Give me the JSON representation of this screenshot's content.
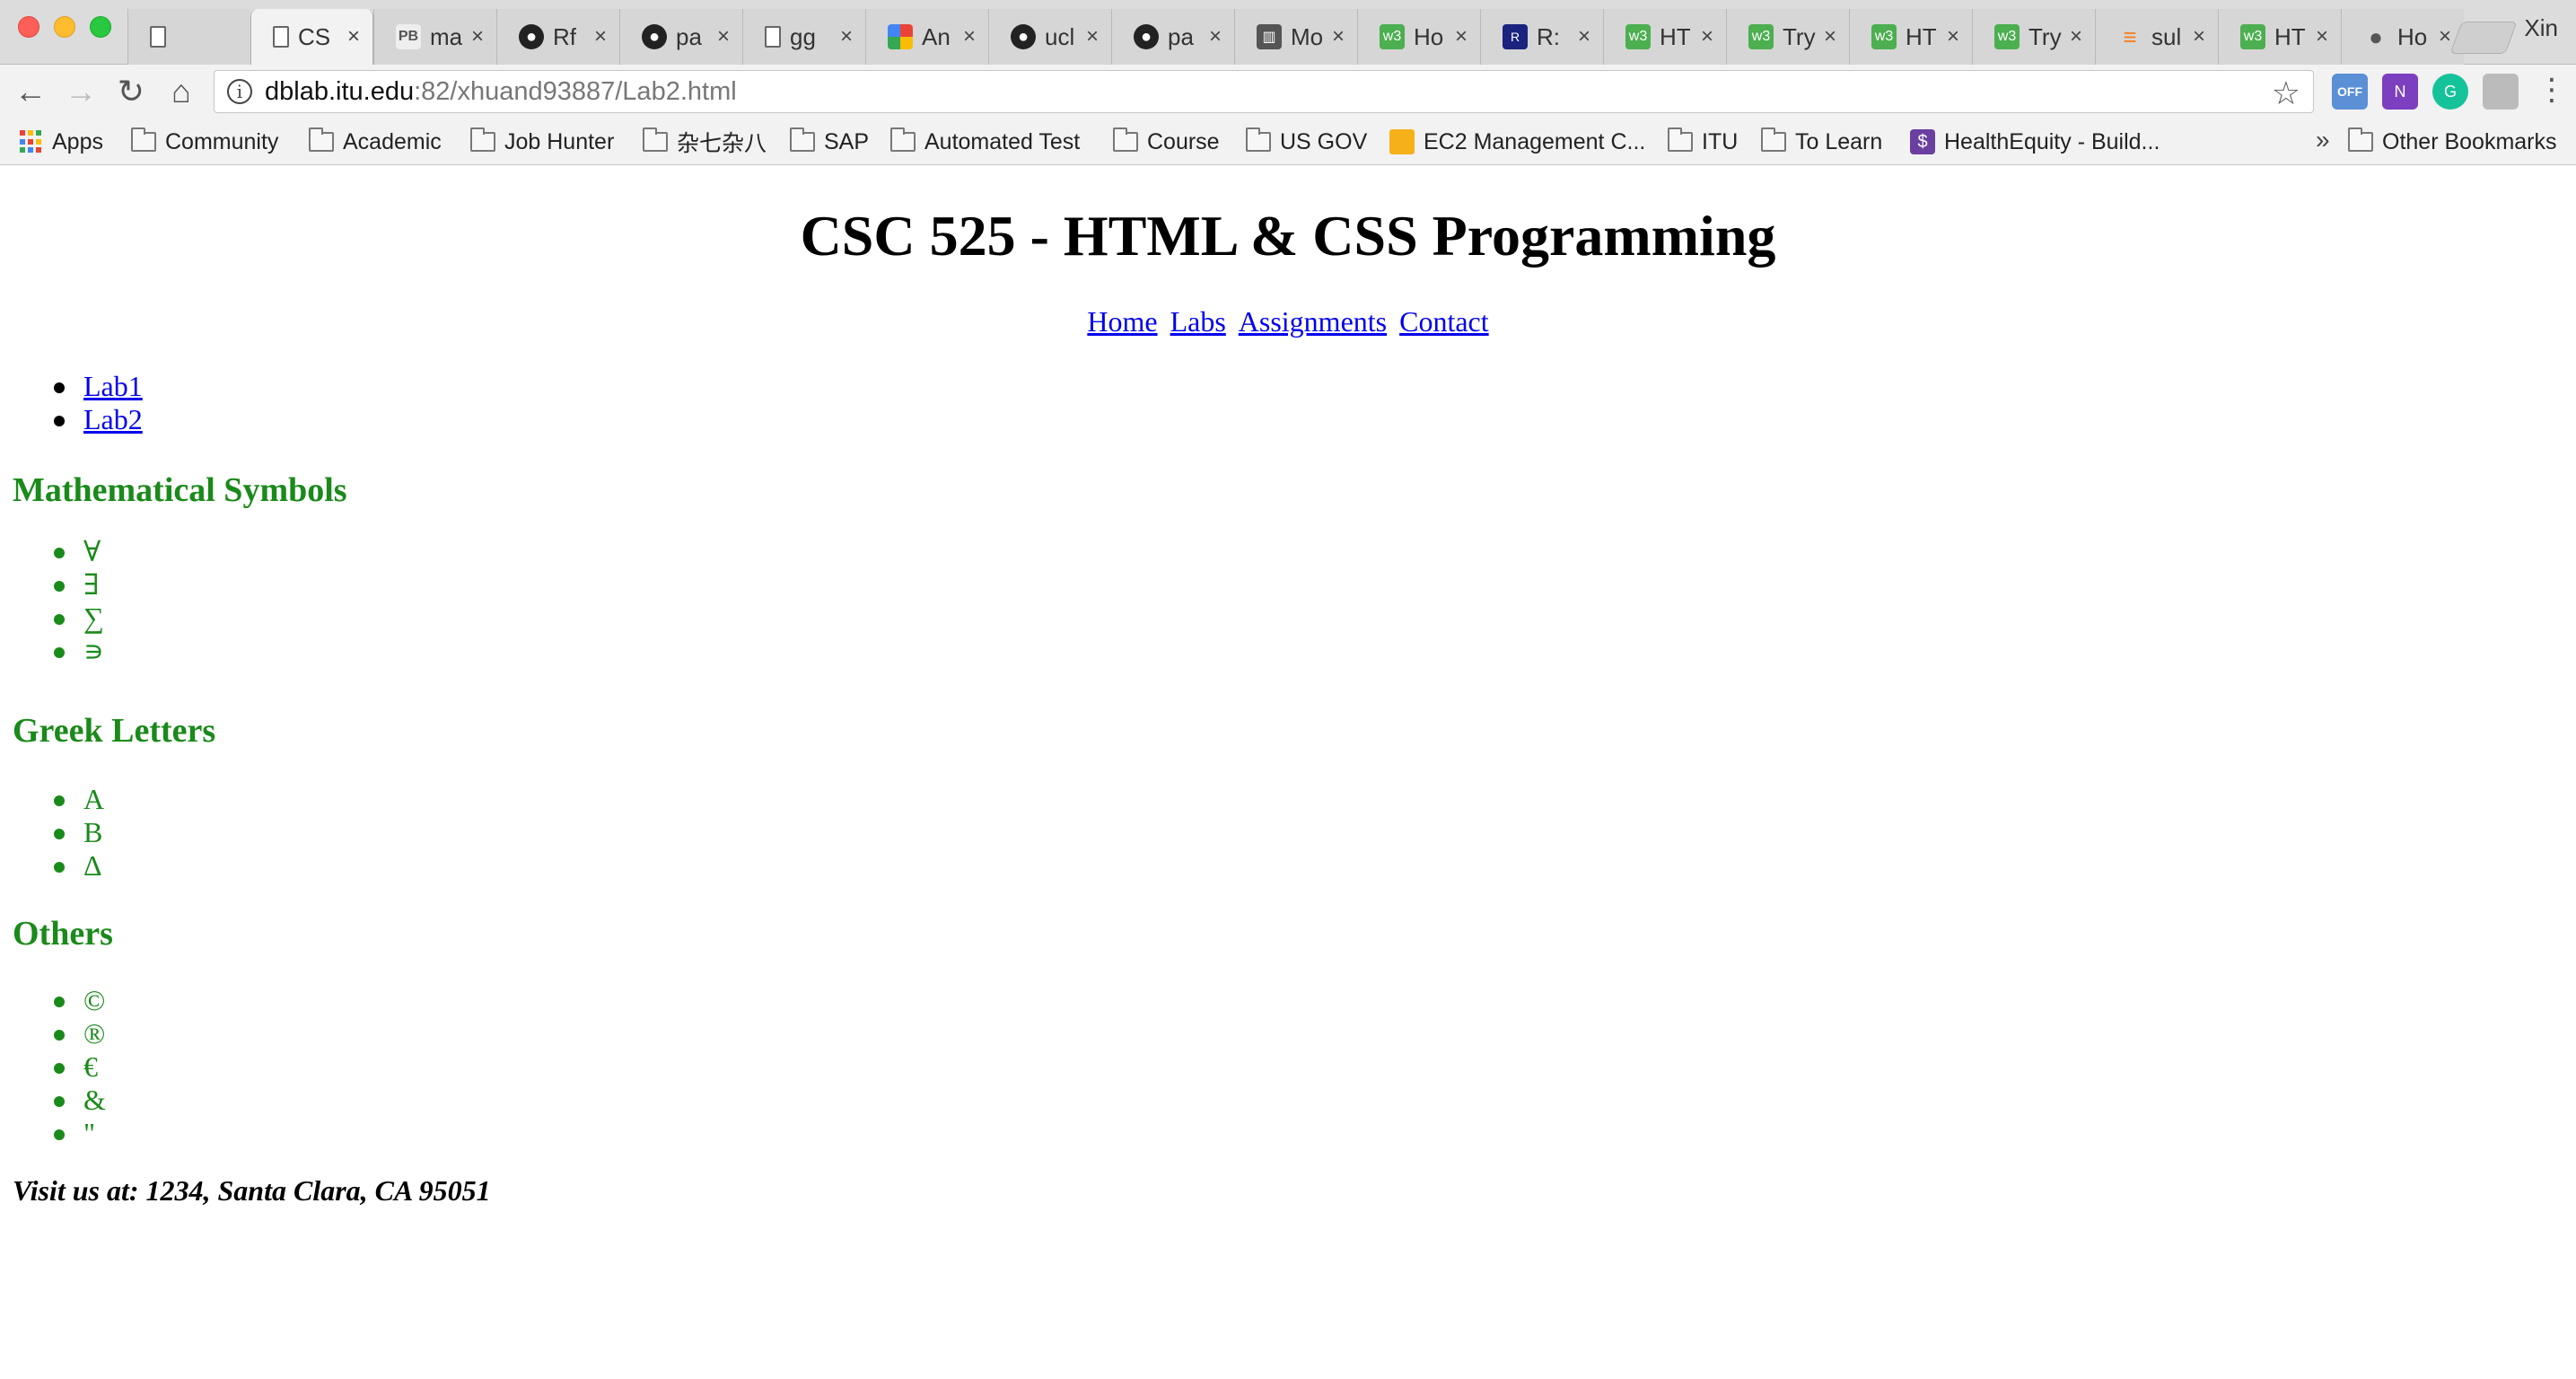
{
  "browser": {
    "tabs": [
      {
        "icon": "page-icon",
        "title": "",
        "active": false
      },
      {
        "icon": "page-icon",
        "title": "CS",
        "active": true
      },
      {
        "icon": "pb-icon",
        "title": "ma",
        "active": false
      },
      {
        "icon": "github-icon",
        "title": "Rf",
        "active": false
      },
      {
        "icon": "github-icon",
        "title": "pa",
        "active": false
      },
      {
        "icon": "page-icon",
        "title": "gg",
        "active": false
      },
      {
        "icon": "colorful-grid-icon",
        "title": "An",
        "active": false
      },
      {
        "icon": "github-icon",
        "title": "ucl",
        "active": false
      },
      {
        "icon": "github-icon",
        "title": "pa",
        "active": false
      },
      {
        "icon": "book-icon",
        "title": "Mo",
        "active": false
      },
      {
        "icon": "w3schools-icon",
        "title": "Ho",
        "active": false
      },
      {
        "icon": "r-icon",
        "title": "R:",
        "active": false
      },
      {
        "icon": "w3schools-icon",
        "title": "HT",
        "active": false
      },
      {
        "icon": "w3schools-icon",
        "title": "Try",
        "active": false
      },
      {
        "icon": "w3schools-icon",
        "title": "HT",
        "active": false
      },
      {
        "icon": "w3schools-icon",
        "title": "Try",
        "active": false
      },
      {
        "icon": "stackoverflow-icon",
        "title": "sul",
        "active": false
      },
      {
        "icon": "w3schools-icon",
        "title": "HT",
        "active": false
      },
      {
        "icon": "apple-icon",
        "title": "Ho",
        "active": false
      }
    ],
    "profile_name": "Xin",
    "url_host": "dblab.itu.edu",
    "url_rest": ":82/xhuand93887/Lab2.html",
    "bookmarks": [
      {
        "label": "Apps",
        "icon": "apps-icon"
      },
      {
        "label": "Community",
        "icon": "folder-icon"
      },
      {
        "label": "Academic",
        "icon": "folder-icon"
      },
      {
        "label": "Job Hunter",
        "icon": "folder-icon"
      },
      {
        "label": "杂七杂八",
        "icon": "folder-icon"
      },
      {
        "label": "SAP",
        "icon": "folder-icon"
      },
      {
        "label": "Automated Test",
        "icon": "folder-icon"
      },
      {
        "label": "Course",
        "icon": "folder-icon"
      },
      {
        "label": "US GOV",
        "icon": "folder-icon"
      },
      {
        "label": "EC2 Management C...",
        "icon": "aws-box-icon"
      },
      {
        "label": "ITU",
        "icon": "folder-icon"
      },
      {
        "label": "To Learn",
        "icon": "folder-icon"
      },
      {
        "label": "HealthEquity - Build...",
        "icon": "healthequity-icon"
      }
    ],
    "overflow_chevron": "»",
    "other_bookmarks": "Other Bookmarks",
    "ext_off_label": "OFF",
    "ext_onenote_label": "N",
    "ext_grammarly_label": "G"
  },
  "page": {
    "title": "CSC 525 - HTML & CSS Programming",
    "nav": [
      "Home",
      "Labs",
      "Assignments",
      "Contact"
    ],
    "labs": [
      "Lab1",
      "Lab2"
    ],
    "sections": [
      {
        "heading": "Mathematical Symbols",
        "items": [
          "∀",
          "∃",
          "∑",
          "∍"
        ]
      },
      {
        "heading": "Greek Letters",
        "items": [
          "Α",
          "Β",
          "Δ"
        ]
      },
      {
        "heading": "Others",
        "items": [
          "©",
          "®",
          "€",
          "&",
          "\""
        ]
      }
    ],
    "address": "Visit us at: 1234, Santa Clara, CA 95051"
  },
  "colors": {
    "heading_green": "#1a8a1a",
    "link_blue": "#0000ee"
  }
}
